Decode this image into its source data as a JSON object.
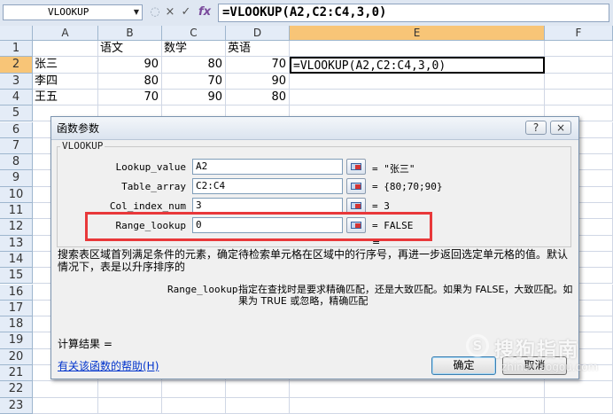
{
  "formula_bar": {
    "name_box": "VLOOKUP",
    "cancel_icon": "×",
    "enter_icon": "✓",
    "fx_icon": "fx",
    "formula": "=VLOOKUP(A2,C2:C4,3,0)"
  },
  "sheet": {
    "columns": [
      "A",
      "B",
      "C",
      "D",
      "E",
      "F"
    ],
    "rows": [
      "1",
      "2",
      "3",
      "4",
      "5",
      "6",
      "7",
      "8",
      "9",
      "10",
      "11",
      "12",
      "13",
      "14",
      "15",
      "16",
      "17",
      "18",
      "19",
      "20",
      "21",
      "22",
      "23"
    ],
    "cells": {
      "B1": "语文",
      "C1": "数学",
      "D1": "英语",
      "A2": "张三",
      "B2": "90",
      "C2": "80",
      "D2": "70",
      "E2": "=VLOOKUP(A2,C2:C4,3,0)",
      "A3": "李四",
      "B3": "80",
      "C3": "70",
      "D3": "90",
      "A4": "王五",
      "B4": "70",
      "C4": "90",
      "D4": "80"
    }
  },
  "dialog": {
    "title": "函数参数",
    "help_button": "?",
    "close_button": "×",
    "function_name": "VLOOKUP",
    "args": [
      {
        "label": "Lookup_value",
        "value": "A2",
        "result": "= \"张三\""
      },
      {
        "label": "Table_array",
        "value": "C2:C4",
        "result": "= {80;70;90}"
      },
      {
        "label": "Col_index_num",
        "value": "3",
        "result": "= 3"
      },
      {
        "label": "Range_lookup",
        "value": "0",
        "result": "= FALSE"
      }
    ],
    "result_equals": "=",
    "description": "搜索表区域首列满足条件的元素，确定待检索单元格在区域中的行序号，再进一步返回选定单元格的值。默认情况下，表是以升序排序的",
    "param_name": "Range_lookup",
    "param_description": "指定在查找时是要求精确匹配，还是大致匹配。如果为 FALSE，大致匹配。如果为 TRUE 或忽略，精确匹配",
    "calc_result_label": "计算结果 =",
    "help_link": "有关该函数的帮助(H)",
    "ok_label": "确定",
    "cancel_label": "取消"
  },
  "watermark": {
    "logo": "S",
    "text": "搜狗指南",
    "url": "zhinan.sogou.com"
  },
  "colors": {
    "header_bg": "#e4ecf7",
    "selected_header": "#f8c577",
    "highlight_box": "#e8383a",
    "link": "#0033cc"
  }
}
